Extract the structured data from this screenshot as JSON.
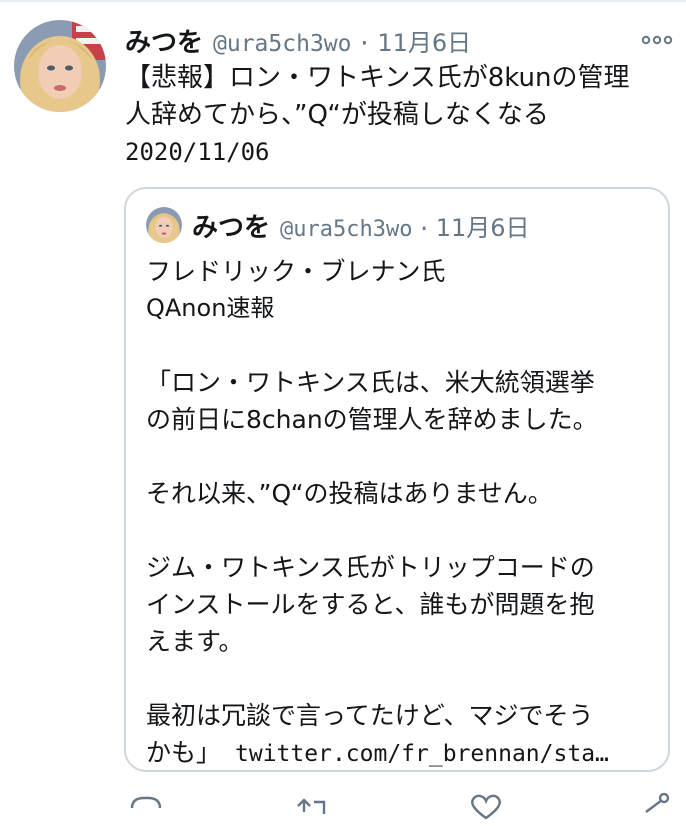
{
  "tweet": {
    "name": "みつを",
    "handle": "@ura5ch3wo",
    "separator": "·",
    "date": "11月6日",
    "text_lines": [
      "【悲報】ロン・ワトキンス氏が8kunの管理",
      "人辞めてから、”Q“が投稿しなくなる",
      "2020/11/06"
    ]
  },
  "quoted_tweet": {
    "name": "みつを",
    "handle": "@ura5ch3wo",
    "separator": "·",
    "date": "11月6日",
    "lines": [
      "フレドリック・ブレナン氏",
      "QAnon速報",
      "",
      "「ロン・ワトキンス氏は、米大統領選挙",
      "の前日に8chanの管理人を辞めました。",
      "",
      "それ以来、”Q“の投稿はありません。",
      "",
      "ジム・ワトキンス氏がトリップコードの",
      "インストールをすると、誰もが問題を抱",
      "えます。",
      "",
      "最初は冗談で言ってたけど、マジでそう"
    ],
    "last_line_text": "かも」",
    "link": "twitter.com/fr_brennan/sta…"
  },
  "icons": {
    "more": "more-dots-icon",
    "reply": "reply-icon",
    "retweet": "retweet-icon",
    "like": "heart-icon",
    "share": "share-icon"
  },
  "colors": {
    "text": "#14171a",
    "secondary": "#657786",
    "border": "#ccd6dd"
  }
}
